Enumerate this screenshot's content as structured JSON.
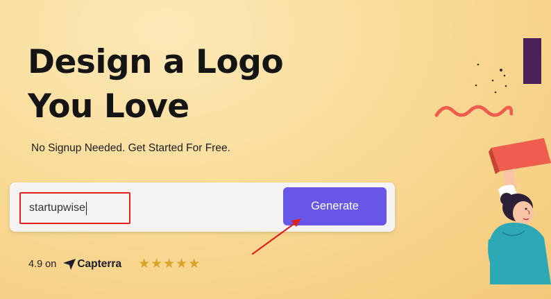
{
  "hero": {
    "headline_line1": "Design a Logo",
    "headline_line2": "You Love",
    "subtitle": "No Signup Needed. Get Started For Free."
  },
  "form": {
    "input_value": "startupwise",
    "button_label": "Generate"
  },
  "rating": {
    "text": "4.9 on",
    "brand": "Capterra",
    "stars": "★★★★★"
  },
  "colors": {
    "accent": "#6756e8",
    "annotation": "#e01f1f",
    "star": "#d9a327"
  },
  "icons": {
    "capterra": "capterra-logo-icon",
    "annotation": "red-annotation-arrow"
  }
}
